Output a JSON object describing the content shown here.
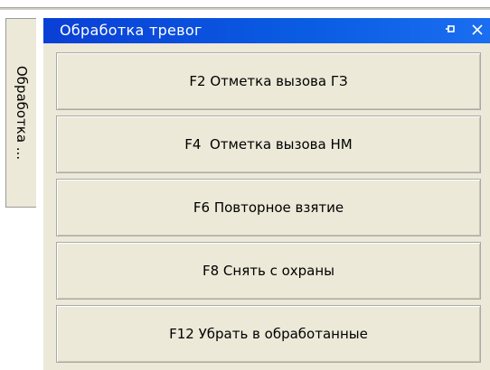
{
  "side_tab": {
    "label": "Обработка ..."
  },
  "panel": {
    "title": "Обработка тревог",
    "icons": [
      "pin-icon",
      "close-icon"
    ]
  },
  "actions": [
    {
      "label": "F2 Отметка вызова ГЗ"
    },
    {
      "label": "F4  Отметка вызова НМ"
    },
    {
      "label": "F6 Повторное взятие"
    },
    {
      "label": "F8 Снять с охраны"
    },
    {
      "label": "F12 Убрать в обработанные"
    }
  ],
  "colors": {
    "titlebar": "#0a4de0",
    "panel_bg": "#ece9d8",
    "title_text": "#ffffff"
  }
}
